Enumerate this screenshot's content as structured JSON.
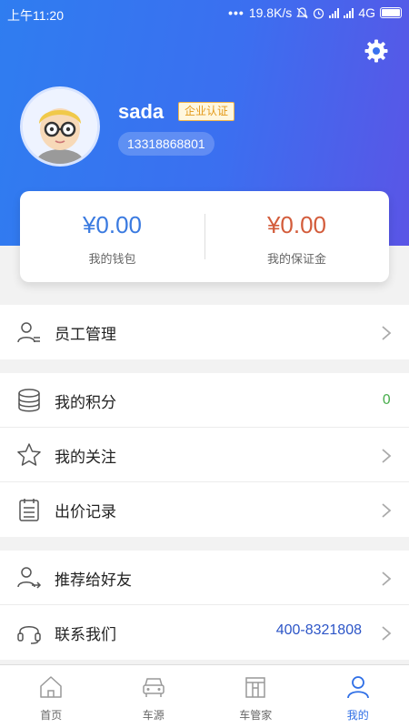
{
  "status_bar": {
    "time": "上午11:20",
    "speed": "19.8K/s",
    "network": "4G"
  },
  "profile": {
    "username": "sada",
    "badge": "企业认证",
    "phone": "13318868801"
  },
  "wallet": {
    "balance": "¥0.00",
    "balance_label": "我的钱包",
    "deposit": "¥0.00",
    "deposit_label": "我的保证金",
    "balance_color": "#3a7ae0",
    "deposit_color": "#d35c3b"
  },
  "menu": {
    "staff": "员工管理",
    "points": "我的积分",
    "points_value": "0",
    "follow": "我的关注",
    "bids": "出价记录",
    "recommend": "推荐给好友",
    "contact": "联系我们",
    "contact_phone": "400-8321808"
  },
  "tabs": [
    {
      "label": "首页",
      "icon": "home-icon"
    },
    {
      "label": "车源",
      "icon": "car-icon"
    },
    {
      "label": "车管家",
      "icon": "garage-icon"
    },
    {
      "label": "我的",
      "icon": "user-icon",
      "active": true
    }
  ],
  "colors": {
    "accent": "#2f6fe6",
    "header_start": "#2f7df0",
    "header_end": "#5a55e6"
  }
}
